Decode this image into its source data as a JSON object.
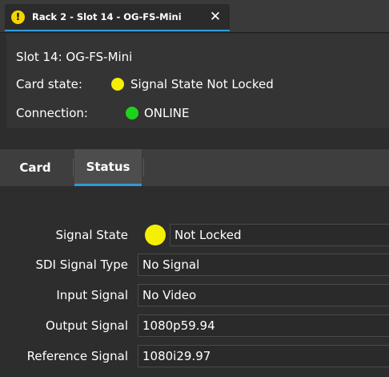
{
  "window_tab": {
    "label": "Rack 2 - Slot 14 - OG-FS-Mini",
    "warning_icon": "warning-icon",
    "warning_glyph": "!",
    "close_icon": "close-icon",
    "close_glyph": "✕"
  },
  "info": {
    "title": "Slot 14: OG-FS-Mini",
    "card_state_label": "Card state:",
    "card_state_value": "Signal State Not Locked",
    "card_state_color": "#f5f000",
    "connection_label": "Connection:",
    "connection_value": "ONLINE",
    "connection_color": "#1ed31e"
  },
  "subtabs": [
    {
      "label": "Card",
      "active": false
    },
    {
      "label": "Status",
      "active": true
    }
  ],
  "status": {
    "signal_state_label": "Signal State",
    "signal_state_value": "Not Locked",
    "signal_state_color": "#f5f000",
    "sdi_signal_type_label": "SDI Signal Type",
    "sdi_signal_type_value": "No Signal",
    "input_signal_label": "Input Signal",
    "input_signal_value": "No Video",
    "output_signal_label": "Output Signal",
    "output_signal_value": "1080p59.94",
    "reference_signal_label": "Reference Signal",
    "reference_signal_value": "1080i29.97"
  },
  "colors": {
    "accent": "#2f9bd6",
    "background": "#2d2d2d"
  }
}
